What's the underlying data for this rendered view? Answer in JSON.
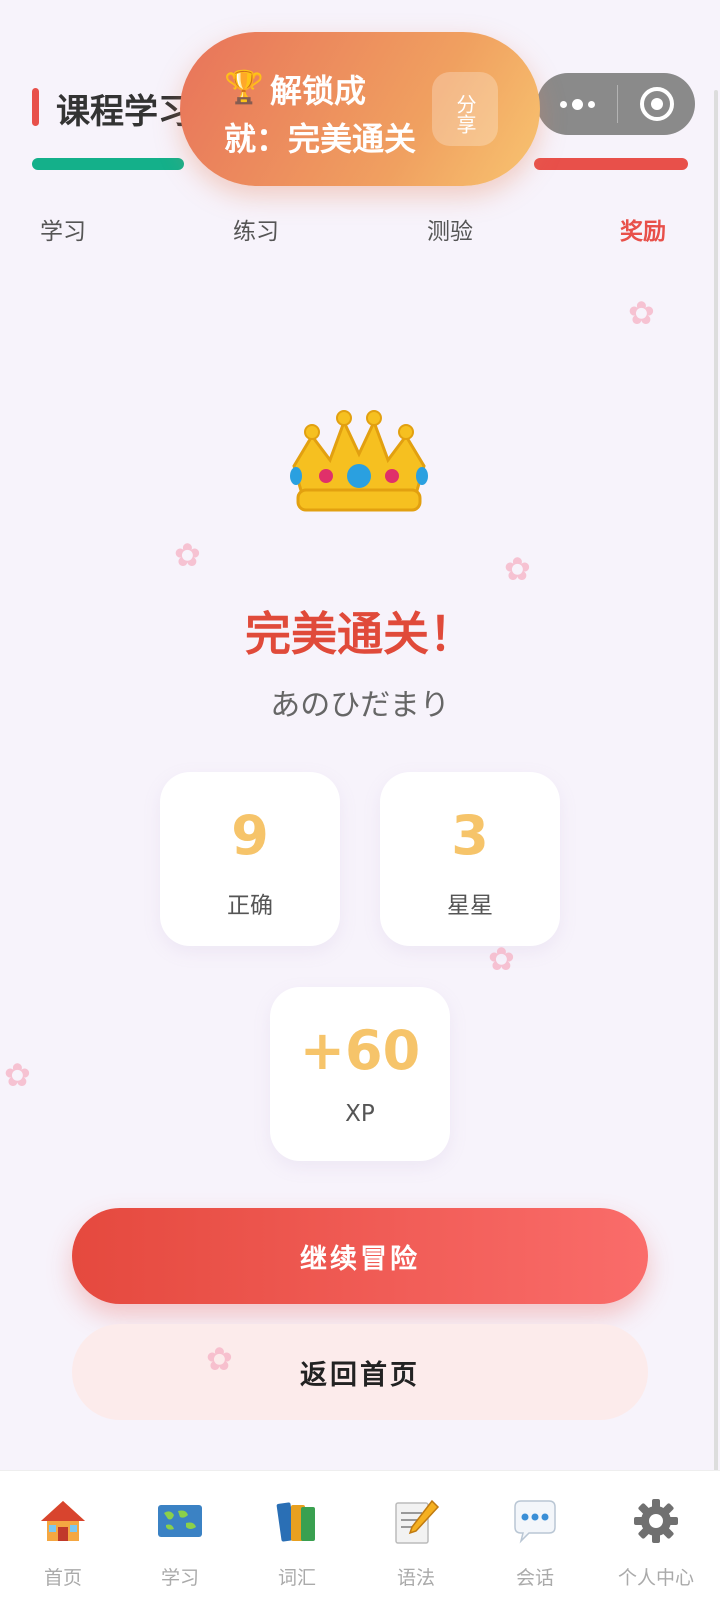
{
  "header": {
    "title": "课程学习"
  },
  "toast": {
    "line1": "解锁成",
    "line2": "就：完美通关",
    "share_label": "分享"
  },
  "tabs": [
    {
      "label": "学习"
    },
    {
      "label": "练习"
    },
    {
      "label": "测验"
    },
    {
      "label": "奖励",
      "active": true
    }
  ],
  "result": {
    "title": "完美通关！",
    "subtitle": "あのひだまり",
    "stats": [
      {
        "value": "9",
        "label": "正确"
      },
      {
        "value": "3",
        "label": "星星"
      },
      {
        "value": "+60",
        "label": "XP"
      }
    ]
  },
  "buttons": {
    "continue": "继续冒险",
    "home": "返回首页"
  },
  "bottom_nav": [
    {
      "label": "首页",
      "icon": "house-icon"
    },
    {
      "label": "学习",
      "icon": "world-map-icon"
    },
    {
      "label": "词汇",
      "icon": "books-icon"
    },
    {
      "label": "语法",
      "icon": "memo-pencil-icon"
    },
    {
      "label": "会话",
      "icon": "speech-bubble-icon"
    },
    {
      "label": "个人中心",
      "icon": "gear-icon"
    }
  ],
  "colors": {
    "accent": "#e8504a",
    "progress": "#14b08a",
    "stat_value": "#f6c46a",
    "toast_start": "#e8735a",
    "toast_end": "#f8c470"
  }
}
